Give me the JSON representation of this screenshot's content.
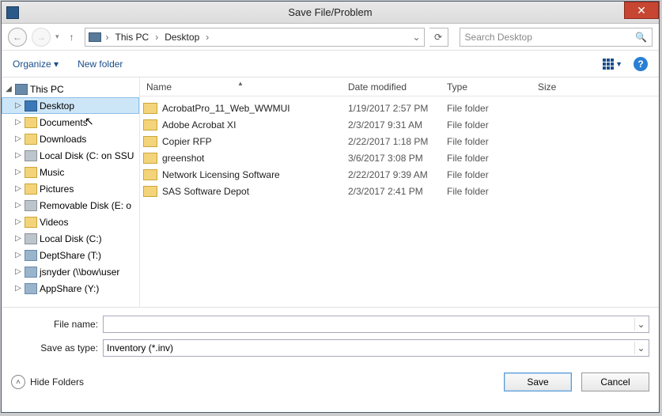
{
  "title": "Save File/Problem",
  "breadcrumb": {
    "root": "This PC",
    "leaf": "Desktop"
  },
  "search": {
    "placeholder": "Search Desktop"
  },
  "toolbar": {
    "organize": "Organize",
    "newfolder": "New folder"
  },
  "tree": {
    "root": "This PC",
    "items": [
      {
        "label": "Desktop",
        "icon": "ico-desktop",
        "selected": true
      },
      {
        "label": "Documents",
        "icon": "ico-folder"
      },
      {
        "label": "Downloads",
        "icon": "ico-folder"
      },
      {
        "label": "Local Disk (C: on SSU",
        "icon": "ico-drive"
      },
      {
        "label": "Music",
        "icon": "ico-folder"
      },
      {
        "label": "Pictures",
        "icon": "ico-folder"
      },
      {
        "label": "Removable Disk (E: o",
        "icon": "ico-drive"
      },
      {
        "label": "Videos",
        "icon": "ico-folder"
      },
      {
        "label": "Local Disk (C:)",
        "icon": "ico-drive"
      },
      {
        "label": "DeptShare (T:)",
        "icon": "ico-net"
      },
      {
        "label": "jsnyder (\\\\bow\\user",
        "icon": "ico-net"
      },
      {
        "label": "AppShare (Y:)",
        "icon": "ico-net"
      }
    ]
  },
  "columns": {
    "name": "Name",
    "date": "Date modified",
    "type": "Type",
    "size": "Size"
  },
  "files": [
    {
      "name": "AcrobatPro_11_Web_WWMUI",
      "date": "1/19/2017 2:57 PM",
      "type": "File folder"
    },
    {
      "name": "Adobe Acrobat XI",
      "date": "2/3/2017 9:31 AM",
      "type": "File folder"
    },
    {
      "name": "Copier RFP",
      "date": "2/22/2017 1:18 PM",
      "type": "File folder"
    },
    {
      "name": "greenshot",
      "date": "3/6/2017 3:08 PM",
      "type": "File folder"
    },
    {
      "name": "Network Licensing Software",
      "date": "2/22/2017 9:39 AM",
      "type": "File folder"
    },
    {
      "name": "SAS Software Depot",
      "date": "2/3/2017 2:41 PM",
      "type": "File folder"
    }
  ],
  "fields": {
    "filename_label": "File name:",
    "filename_value": "",
    "saveas_label": "Save as type:",
    "saveas_value": "Inventory (*.inv)"
  },
  "footer": {
    "hide": "Hide Folders",
    "save": "Save",
    "cancel": "Cancel"
  }
}
